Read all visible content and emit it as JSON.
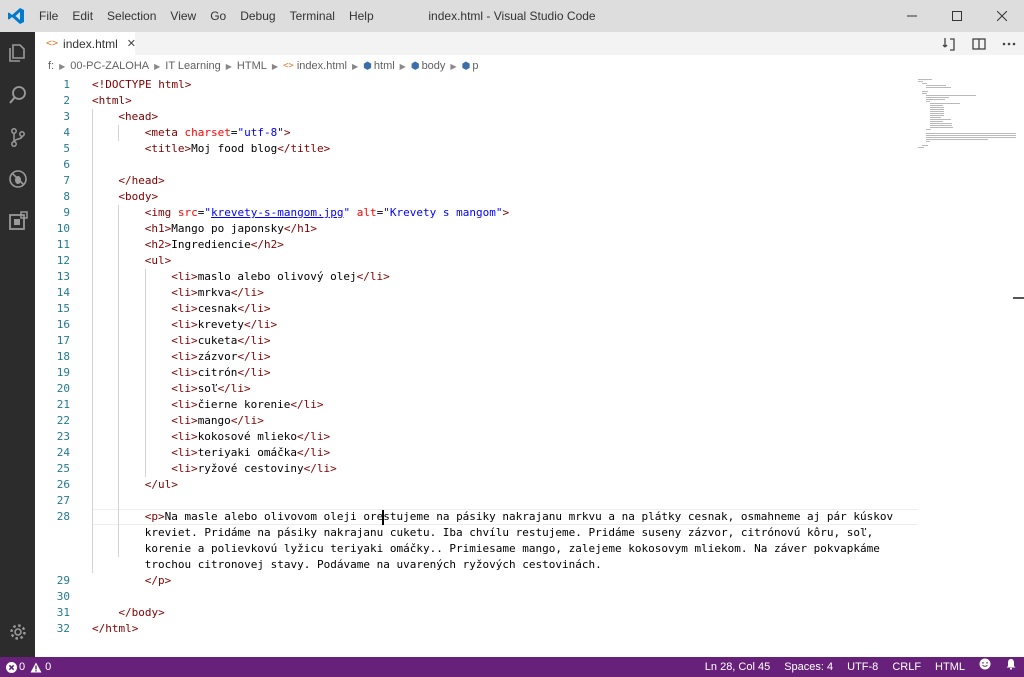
{
  "window": {
    "title": "index.html - Visual Studio Code"
  },
  "menu": [
    "File",
    "Edit",
    "Selection",
    "View",
    "Go",
    "Debug",
    "Terminal",
    "Help"
  ],
  "window_controls": {
    "minimize": "—",
    "maximize": "☐",
    "close": "✕"
  },
  "tab": {
    "icon_text": "<>",
    "label": "index.html",
    "close": "✕"
  },
  "breadcrumbs": [
    "f:",
    "00-PC-ZALOHA",
    "IT Learning",
    "HTML",
    "index.html",
    "html",
    "body",
    "p"
  ],
  "editor": {
    "lines": [
      {
        "n": "1",
        "indent": 0,
        "parts": [
          [
            "tag",
            "<!DOCTYPE html>"
          ]
        ]
      },
      {
        "n": "2",
        "indent": 0,
        "parts": [
          [
            "tag",
            "<html>"
          ]
        ]
      },
      {
        "n": "3",
        "indent": 1,
        "parts": [
          [
            "tag",
            "<head>"
          ]
        ]
      },
      {
        "n": "4",
        "indent": 2,
        "parts": [
          [
            "tag",
            "<meta "
          ],
          [
            "attr",
            "charset"
          ],
          [
            "txt",
            "="
          ],
          [
            "str",
            "\"utf-8\""
          ],
          [
            "tag",
            ">"
          ]
        ]
      },
      {
        "n": "5",
        "indent": 2,
        "parts": [
          [
            "tag",
            "<title>"
          ],
          [
            "txt",
            "Moj food blog"
          ],
          [
            "tag",
            "</title>"
          ]
        ]
      },
      {
        "n": "6",
        "indent": 0,
        "parts": []
      },
      {
        "n": "7",
        "indent": 1,
        "parts": [
          [
            "tag",
            "</head>"
          ]
        ]
      },
      {
        "n": "8",
        "indent": 1,
        "parts": [
          [
            "tag",
            "<body>"
          ]
        ]
      },
      {
        "n": "9",
        "indent": 2,
        "parts": [
          [
            "tag",
            "<img "
          ],
          [
            "attr",
            "src"
          ],
          [
            "txt",
            "="
          ],
          [
            "str",
            "\""
          ],
          [
            "strlink",
            "krevety-s-mangom.jpg"
          ],
          [
            "str",
            "\""
          ],
          [
            "tag",
            " "
          ],
          [
            "attr",
            "alt"
          ],
          [
            "txt",
            "="
          ],
          [
            "str",
            "\"Krevety s mangom\""
          ],
          [
            "tag",
            ">"
          ]
        ]
      },
      {
        "n": "10",
        "indent": 2,
        "parts": [
          [
            "tag",
            "<h1>"
          ],
          [
            "txt",
            "Mango po japonsky"
          ],
          [
            "tag",
            "</h1>"
          ]
        ]
      },
      {
        "n": "11",
        "indent": 2,
        "parts": [
          [
            "tag",
            "<h2>"
          ],
          [
            "txt",
            "Ingrediencie"
          ],
          [
            "tag",
            "</h2>"
          ]
        ]
      },
      {
        "n": "12",
        "indent": 2,
        "parts": [
          [
            "tag",
            "<ul>"
          ]
        ]
      },
      {
        "n": "13",
        "indent": 3,
        "parts": [
          [
            "tag",
            "<li>"
          ],
          [
            "txt",
            "maslo alebo olivový olej"
          ],
          [
            "tag",
            "</li>"
          ]
        ]
      },
      {
        "n": "14",
        "indent": 3,
        "parts": [
          [
            "tag",
            "<li>"
          ],
          [
            "txt",
            "mrkva"
          ],
          [
            "tag",
            "</li>"
          ]
        ]
      },
      {
        "n": "15",
        "indent": 3,
        "parts": [
          [
            "tag",
            "<li>"
          ],
          [
            "txt",
            "cesnak"
          ],
          [
            "tag",
            "</li>"
          ]
        ]
      },
      {
        "n": "16",
        "indent": 3,
        "parts": [
          [
            "tag",
            "<li>"
          ],
          [
            "txt",
            "krevety"
          ],
          [
            "tag",
            "</li>"
          ]
        ]
      },
      {
        "n": "17",
        "indent": 3,
        "parts": [
          [
            "tag",
            "<li>"
          ],
          [
            "txt",
            "cuketa"
          ],
          [
            "tag",
            "</li>"
          ]
        ]
      },
      {
        "n": "18",
        "indent": 3,
        "parts": [
          [
            "tag",
            "<li>"
          ],
          [
            "txt",
            "zázvor"
          ],
          [
            "tag",
            "</li>"
          ]
        ]
      },
      {
        "n": "19",
        "indent": 3,
        "parts": [
          [
            "tag",
            "<li>"
          ],
          [
            "txt",
            "citrón"
          ],
          [
            "tag",
            "</li>"
          ]
        ]
      },
      {
        "n": "20",
        "indent": 3,
        "parts": [
          [
            "tag",
            "<li>"
          ],
          [
            "txt",
            "soľ"
          ],
          [
            "tag",
            "</li>"
          ]
        ]
      },
      {
        "n": "21",
        "indent": 3,
        "parts": [
          [
            "tag",
            "<li>"
          ],
          [
            "txt",
            "čierne korenie"
          ],
          [
            "tag",
            "</li>"
          ]
        ]
      },
      {
        "n": "22",
        "indent": 3,
        "parts": [
          [
            "tag",
            "<li>"
          ],
          [
            "txt",
            "mango"
          ],
          [
            "tag",
            "</li>"
          ]
        ]
      },
      {
        "n": "23",
        "indent": 3,
        "parts": [
          [
            "tag",
            "<li>"
          ],
          [
            "txt",
            "kokosové mlieko"
          ],
          [
            "tag",
            "</li>"
          ]
        ]
      },
      {
        "n": "24",
        "indent": 3,
        "parts": [
          [
            "tag",
            "<li>"
          ],
          [
            "txt",
            "teriyaki omáčka"
          ],
          [
            "tag",
            "</li>"
          ]
        ]
      },
      {
        "n": "25",
        "indent": 3,
        "parts": [
          [
            "tag",
            "<li>"
          ],
          [
            "txt",
            "ryžové cestoviny"
          ],
          [
            "tag",
            "</li>"
          ]
        ]
      },
      {
        "n": "26",
        "indent": 2,
        "parts": [
          [
            "tag",
            "</ul>"
          ]
        ]
      },
      {
        "n": "27",
        "indent": 0,
        "parts": []
      },
      {
        "n": "28",
        "indent": 2,
        "parts": [
          [
            "tag",
            "<p>"
          ],
          [
            "txt",
            "Na masle alebo olivovom oleji orestujeme na pásiky nakrajanu mrkvu a na plátky cesnak, osmahneme aj pár kúskov"
          ]
        ]
      },
      {
        "n": "",
        "indent": 2,
        "parts": [
          [
            "txt",
            "kreviet. Pridáme na pásiky nakrajanu cuketu. Iba chvílu restujeme. Pridáme suseny zázvor, citrónovú kôru, soľ,"
          ]
        ]
      },
      {
        "n": "",
        "indent": 2,
        "parts": [
          [
            "txt",
            "korenie a polievkovú lyžicu teriyaki omáčky.. Primiesame mango, zalejeme kokosovym mliekom. Na záver pokvapkáme"
          ]
        ]
      },
      {
        "n": "",
        "indent": 2,
        "parts": [
          [
            "txt",
            "trochou citronovej stavy. Podávame na uvarených ryžových cestovinách."
          ]
        ]
      },
      {
        "n": "29",
        "indent": 2,
        "parts": [
          [
            "tag",
            "</p>"
          ]
        ]
      },
      {
        "n": "30",
        "indent": 0,
        "parts": []
      },
      {
        "n": "31",
        "indent": 1,
        "parts": [
          [
            "tag",
            "</body>"
          ]
        ]
      },
      {
        "n": "32",
        "indent": 0,
        "parts": [
          [
            "tag",
            "</html>"
          ]
        ]
      }
    ]
  },
  "statusbar": {
    "errors": "0",
    "warnings": "0",
    "position": "Ln 28, Col 45",
    "spaces": "Spaces: 4",
    "encoding": "UTF-8",
    "eol": "CRLF",
    "language": "HTML"
  },
  "colors": {
    "statusbar": "#68217a",
    "activitybar": "#2c2c2c",
    "tag": "#800000",
    "attribute": "#ff0000",
    "string": "#0000ff"
  },
  "icons": {
    "activity": [
      "files-icon",
      "search-icon",
      "source-control-icon",
      "debug-icon",
      "extensions-icon"
    ],
    "activity_bottom": "settings-gear-icon"
  }
}
